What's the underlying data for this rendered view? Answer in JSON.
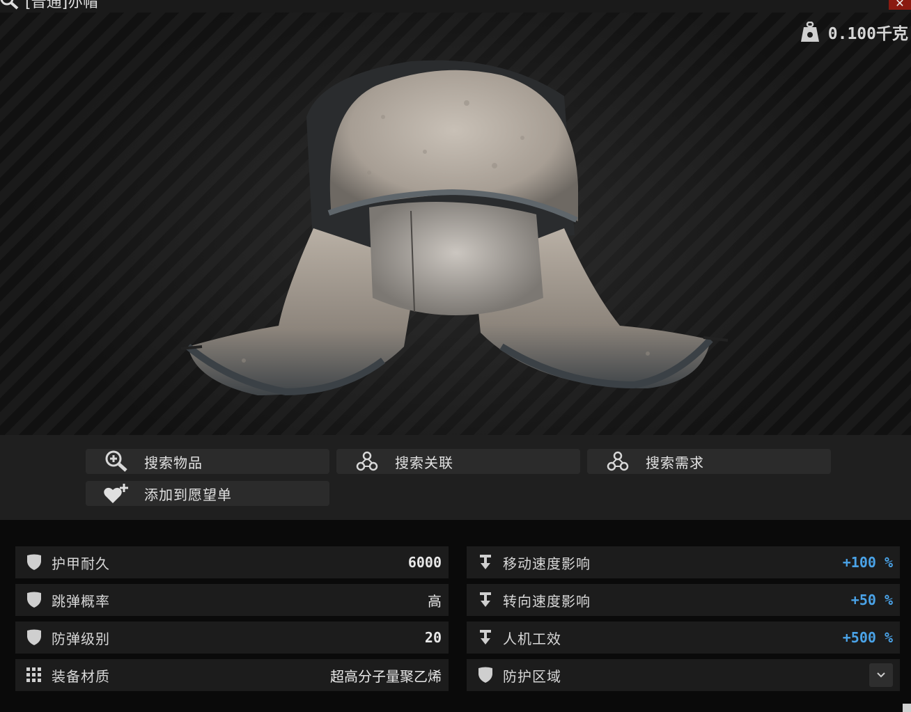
{
  "window": {
    "title": "[普通]亦帽",
    "close_icon": "close-icon"
  },
  "item": {
    "weight": "0.100千克",
    "weight_icon": "weight-icon",
    "image": "ushanka-hat"
  },
  "actions": [
    {
      "label": "搜索物品",
      "icon": "magnify-plus-icon"
    },
    {
      "label": "搜索关联",
      "icon": "nodes-icon"
    },
    {
      "label": "搜索需求",
      "icon": "nodes-icon"
    },
    {
      "label": "添加到愿望单",
      "icon": "heart-plus-icon"
    }
  ],
  "stats_left": [
    {
      "label": "护甲耐久",
      "value": "6000",
      "icon": "shield-icon"
    },
    {
      "label": "跳弹概率",
      "value": "高",
      "icon": "shield-icon"
    },
    {
      "label": "防弹级别",
      "value": "20",
      "icon": "shield-icon"
    },
    {
      "label": "装备材质",
      "value": "超高分子量聚乙烯",
      "icon": "grid-icon"
    }
  ],
  "stats_right": [
    {
      "label": "移动速度影响",
      "value": "+100 %",
      "icon": "weight-down-icon"
    },
    {
      "label": "转向速度影响",
      "value": "+50 %",
      "icon": "weight-down-icon"
    },
    {
      "label": "人机工效",
      "value": "+500 %",
      "icon": "weight-down-icon"
    },
    {
      "label": "防护区域",
      "value": "",
      "icon": "shield-icon"
    }
  ],
  "colors": {
    "accent_blue": "#4aa3e8",
    "close_red": "#8a1a10"
  }
}
